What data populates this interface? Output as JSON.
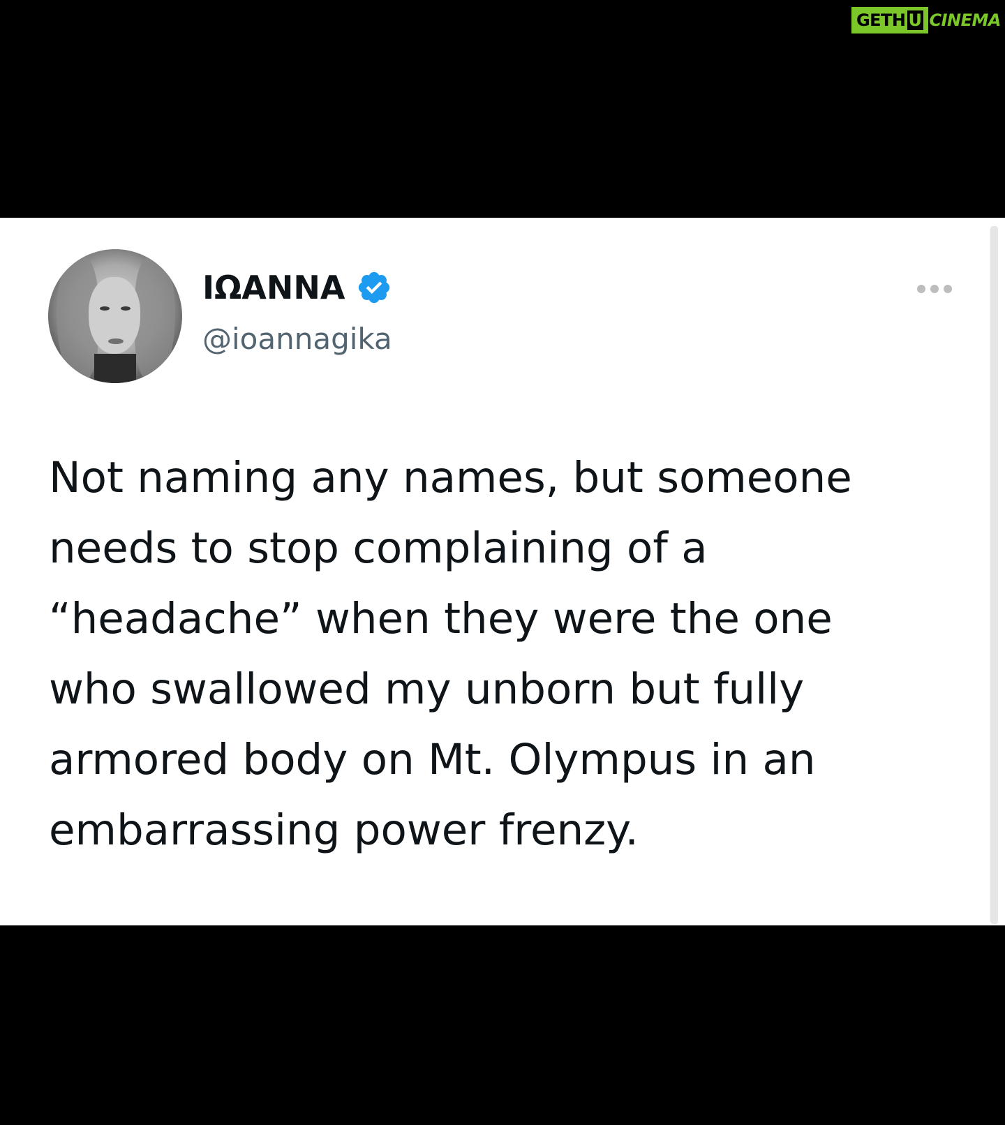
{
  "watermark": {
    "part1": "GETH",
    "part2": "U",
    "part3": "CINEMA"
  },
  "tweet": {
    "display_name": "ΙΩΑΝΝΑ",
    "verified_icon": "verified-badge-icon",
    "handle": "@ioannagika",
    "more_icon": "more-options-icon",
    "text_lines": [
      "Not naming any names, but someone",
      "needs to stop complaining of a",
      "“headache” when they were the one",
      "who swallowed my unborn but fully",
      "armored body on Mt. Olympus in an",
      "embarrassing power frenzy."
    ]
  },
  "colors": {
    "background": "#000000",
    "card": "#ffffff",
    "text": "#0f1419",
    "handle": "#536471",
    "verified": "#1d9bf0",
    "watermark": "#7bc628"
  }
}
